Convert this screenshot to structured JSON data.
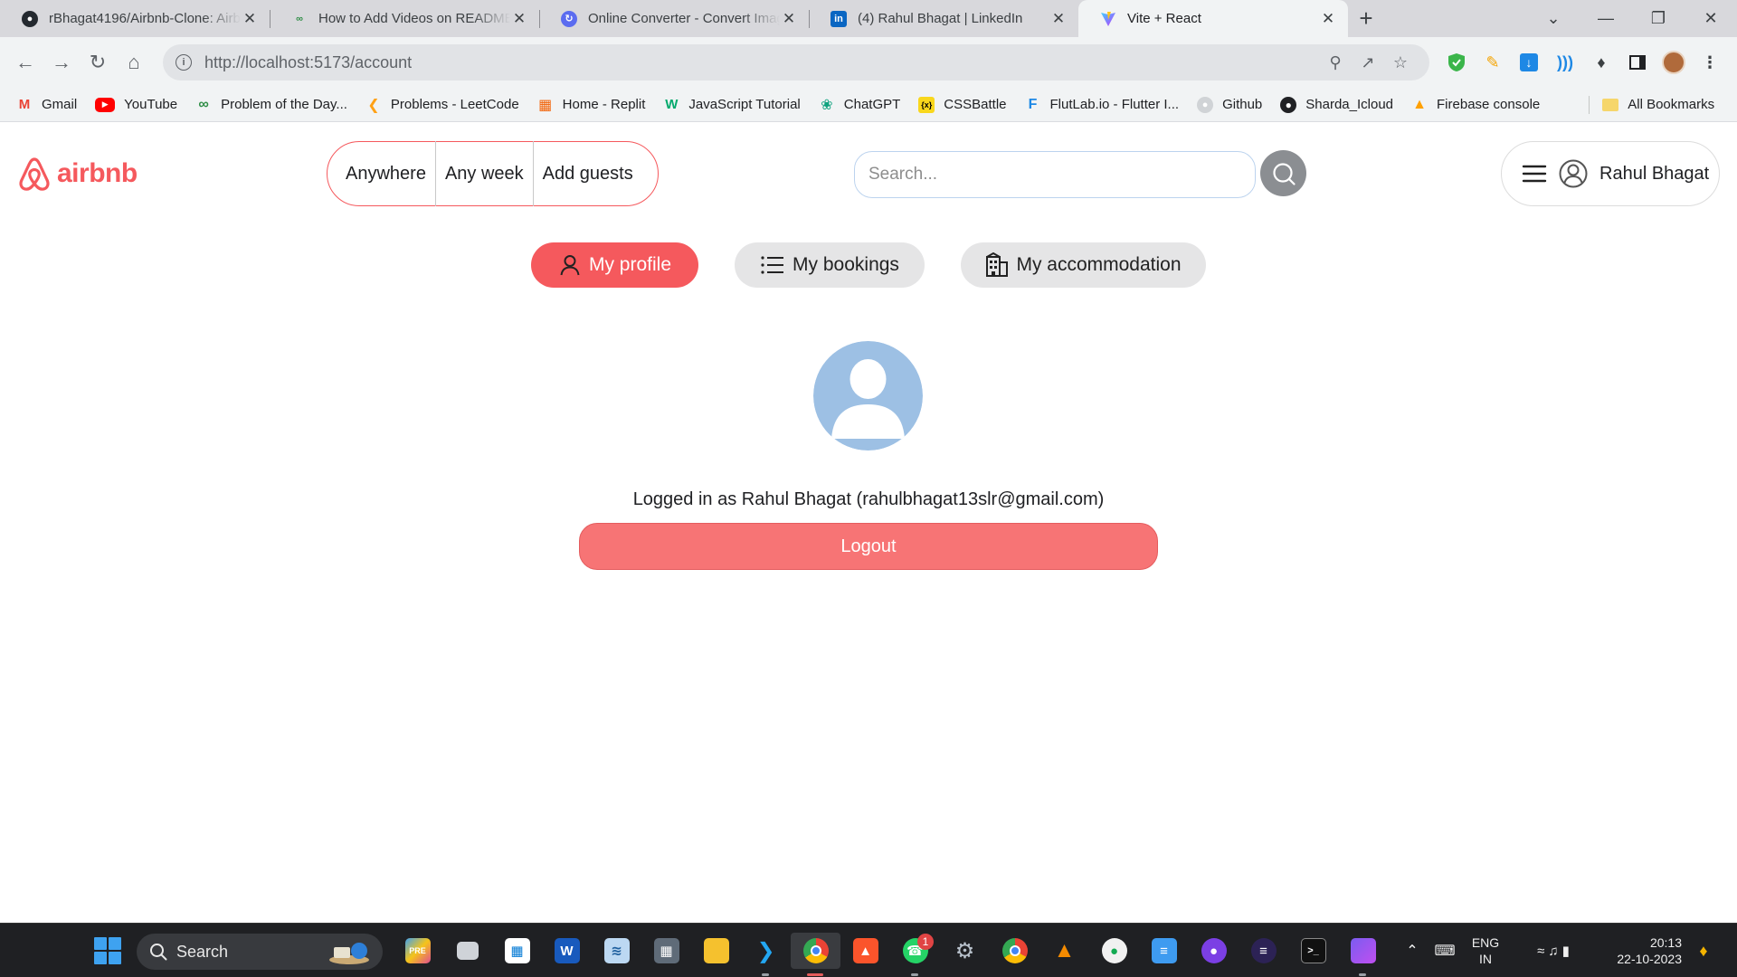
{
  "browser": {
    "tabs": [
      {
        "title": "rBhagat4196/Airbnb-Clone: Airb",
        "favicon": "github-icon",
        "active": false
      },
      {
        "title": "How to Add Videos on README",
        "favicon": "geeksforgeeks-icon",
        "active": false
      },
      {
        "title": "Online Converter - Convert Imag",
        "favicon": "converter-icon",
        "active": false
      },
      {
        "title": "(4) Rahul Bhagat | LinkedIn",
        "favicon": "linkedin-icon",
        "active": false
      },
      {
        "title": "Vite + React",
        "favicon": "vite-icon",
        "active": true
      }
    ],
    "url": "http://localhost:5173/account",
    "bookmarks": [
      {
        "label": "Gmail",
        "icon": "gmail-icon",
        "color": "#ea4335"
      },
      {
        "label": "YouTube",
        "icon": "youtube-icon",
        "color": "#ff0000"
      },
      {
        "label": "Problem of the Day...",
        "icon": "geeksforgeeks-icon",
        "color": "#2f8d46"
      },
      {
        "label": "Problems - LeetCode",
        "icon": "leetcode-icon",
        "color": "#ffa116"
      },
      {
        "label": "Home - Replit",
        "icon": "replit-icon",
        "color": "#f26207"
      },
      {
        "label": "JavaScript Tutorial",
        "icon": "w3schools-icon",
        "color": "#04aa6d"
      },
      {
        "label": "ChatGPT",
        "icon": "chatgpt-icon",
        "color": "#10a37f"
      },
      {
        "label": "CSSBattle",
        "icon": "cssbattle-icon",
        "color": "#f9d71c"
      },
      {
        "label": "FlutLab.io - Flutter I...",
        "icon": "flutlab-icon",
        "color": "#1e88e5"
      },
      {
        "label": "Github",
        "icon": "github-icon",
        "color": "#6e7681"
      },
      {
        "label": "Sharda_Icloud",
        "icon": "globe-icon",
        "color": "#202124"
      },
      {
        "label": "Firebase console",
        "icon": "firebase-icon",
        "color": "#ffa000"
      }
    ],
    "all_bookmarks": "All Bookmarks"
  },
  "header": {
    "logo_text": "airbnb",
    "search_pill": {
      "anywhere": "Anywhere",
      "any_week": "Any week",
      "add_guests": "Add guests"
    },
    "search_placeholder": "Search...",
    "user_name": "Rahul Bhagat"
  },
  "account_tabs": [
    {
      "label": "My profile",
      "icon": "user-icon",
      "active": true
    },
    {
      "label": "My bookings",
      "icon": "list-icon",
      "active": false
    },
    {
      "label": "My accommodation",
      "icon": "building-icon",
      "active": false
    }
  ],
  "profile": {
    "logged_in_text": "Logged in as Rahul Bhagat (rahulbhagat13slr@gmail.com)",
    "logout_label": "Logout"
  },
  "taskbar": {
    "search_label": "Search",
    "lang_line1": "ENG",
    "lang_line2": "IN",
    "time": "20:13",
    "date": "22-10-2023",
    "whatsapp_badge": "1"
  },
  "colors": {
    "brand": "#f5595d",
    "logout": "#f77475",
    "avatar": "#9dc0e4"
  }
}
